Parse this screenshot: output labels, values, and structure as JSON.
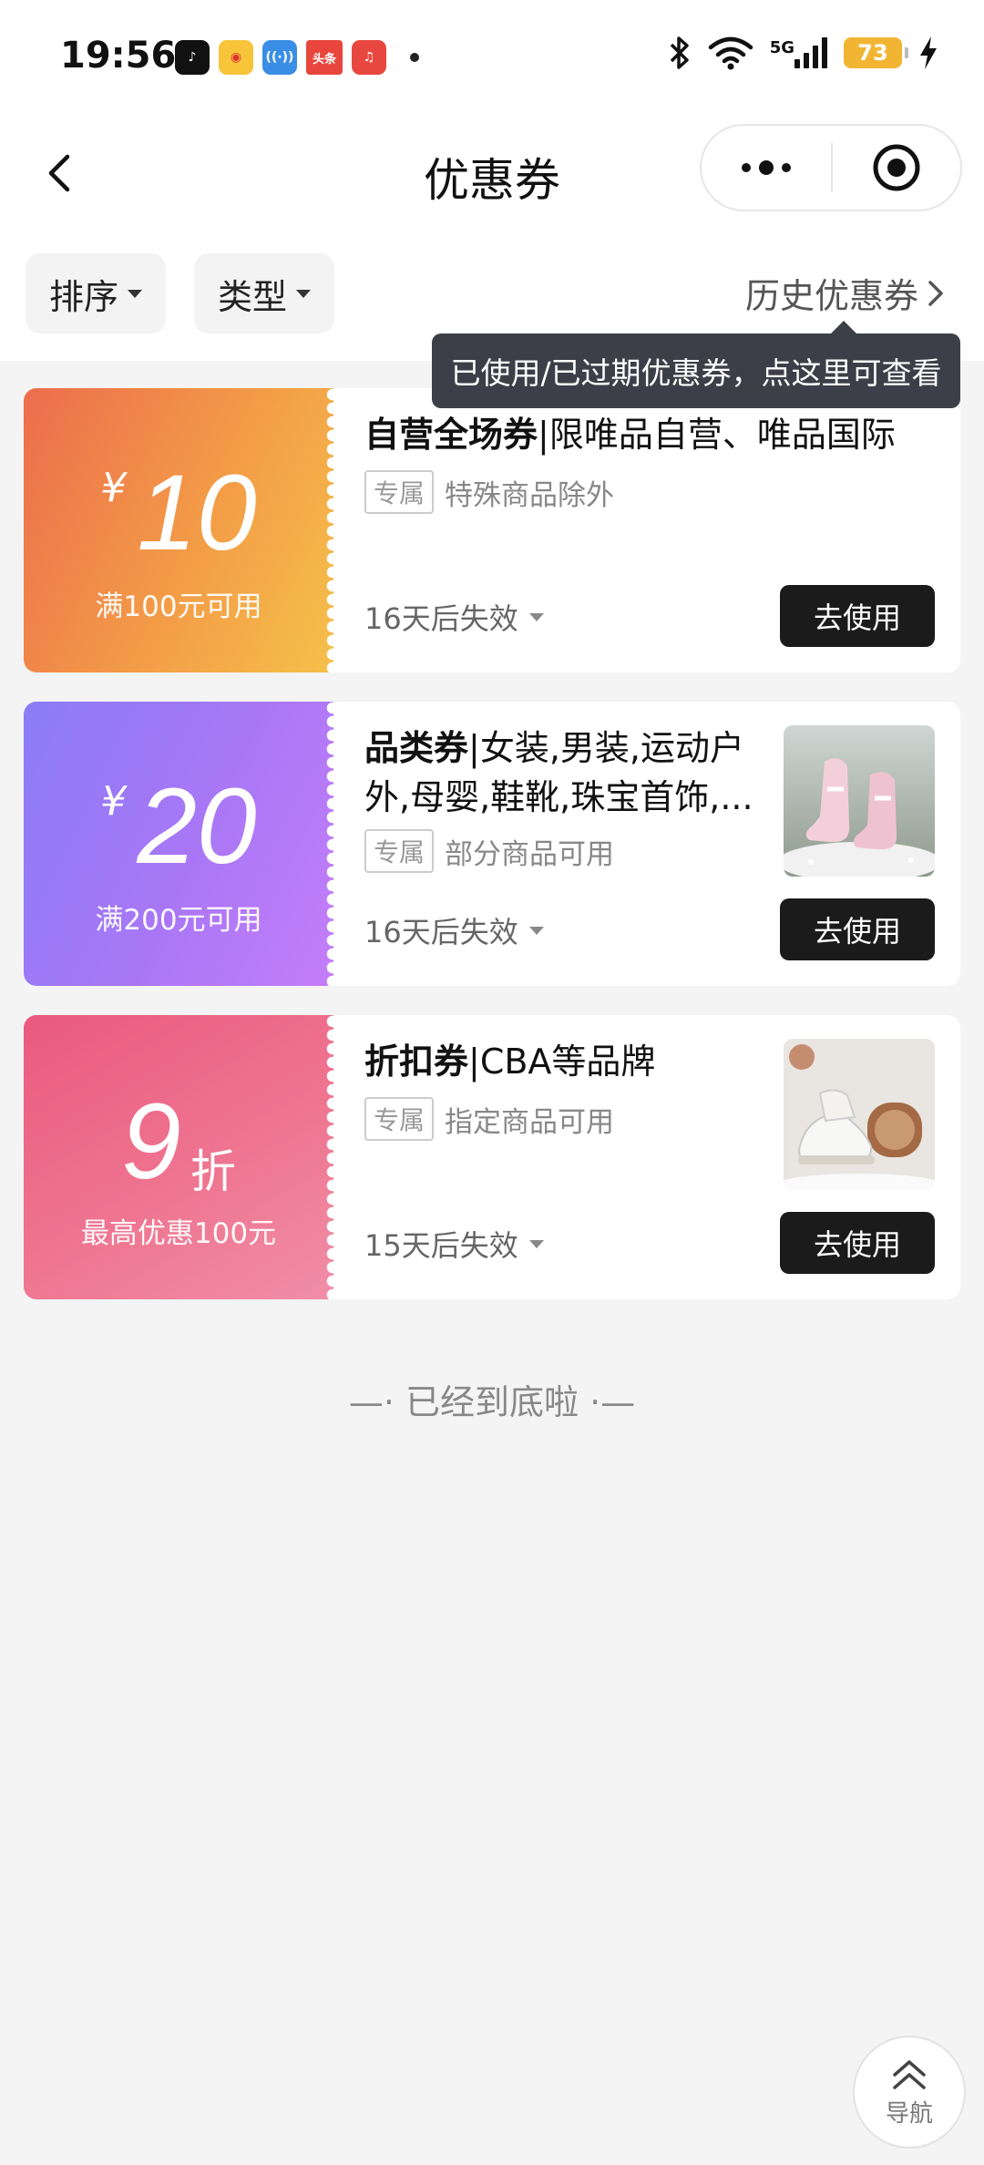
{
  "status": {
    "time": "19:56",
    "network": "5G",
    "battery": "73",
    "app_icons": [
      {
        "name": "douyin",
        "color": "#111111",
        "glyph": "♪"
      },
      {
        "name": "weibo",
        "color": "#f7c43a",
        "glyph": "◉"
      },
      {
        "name": "radio",
        "color": "#3a8ee6",
        "glyph": "📶"
      },
      {
        "name": "toutiao",
        "color": "#e8463c",
        "glyph": "头条"
      },
      {
        "name": "music",
        "color": "#e8473f",
        "glyph": "♫"
      }
    ]
  },
  "nav": {
    "title": "优惠券"
  },
  "filters": {
    "sort_label": "排序",
    "type_label": "类型",
    "history_label": "历史优惠券"
  },
  "tooltip": "已使用/已过期优惠券，点这里可查看",
  "coupons": [
    {
      "yen": "¥",
      "value": "10",
      "suffix": "",
      "condition": "满100元可用",
      "title_bold": "自营全场券",
      "title_rest": "|限唯品自营、唯品国际",
      "tag": "专属",
      "scope": "特殊商品除外",
      "expire": "16天后失效",
      "button": "去使用",
      "has_thumb": false
    },
    {
      "yen": "¥",
      "value": "20",
      "suffix": "",
      "condition": "满200元可用",
      "title_bold": "品类券",
      "title_rest": "|女装,男装,运动户外,母婴,鞋靴,珠宝首饰,...",
      "tag": "专属",
      "scope": "部分商品可用",
      "expire": "16天后失效",
      "button": "去使用",
      "has_thumb": true
    },
    {
      "yen": "",
      "value": "9",
      "suffix": "折",
      "condition": "最高优惠100元",
      "title_bold": "折扣券",
      "title_rest": "|CBA等品牌",
      "tag": "专属",
      "scope": "指定商品可用",
      "expire": "15天后失效",
      "button": "去使用",
      "has_thumb": true
    }
  ],
  "bottom_tip": "—· 已经到底啦 ·—",
  "fab_label": "导航"
}
